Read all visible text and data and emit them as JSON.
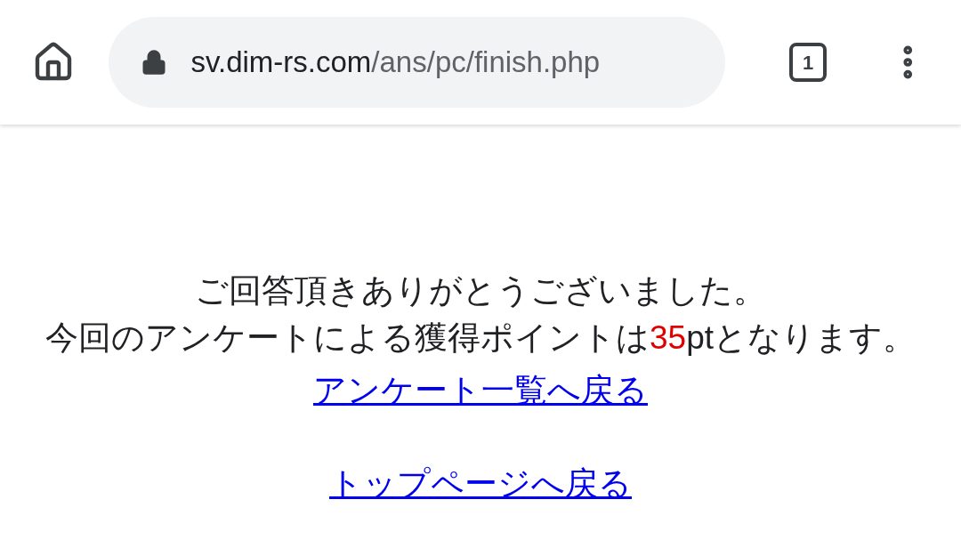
{
  "toolbar": {
    "url_host": "sv.dim-rs.com",
    "url_path": "/ans/pc/finish.php",
    "tab_count": "1"
  },
  "message": {
    "line1": "ご回答頂きありがとうございました。",
    "line2_before": "今回のアンケートによる獲得ポイントは",
    "points": "35",
    "line2_after": "ptとなります。"
  },
  "links": [
    "アンケート一覧へ戻る",
    "トップページへ戻る"
  ]
}
